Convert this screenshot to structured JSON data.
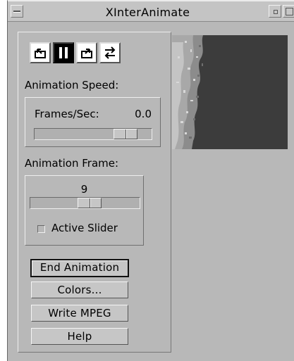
{
  "window": {
    "title": "XInterAnimate"
  },
  "controls": {
    "buttons": [
      {
        "name": "step-backward",
        "icon": "step-backward-icon"
      },
      {
        "name": "pause",
        "icon": "pause-icon",
        "active": true
      },
      {
        "name": "step-forward",
        "icon": "step-forward-icon"
      },
      {
        "name": "loop-toggle",
        "icon": "loop-arrows-icon"
      }
    ]
  },
  "speed": {
    "heading": "Animation Speed:",
    "frames_label": "Frames/Sec:",
    "frames_value": "0.0",
    "slider_position": 0.85
  },
  "frame": {
    "heading": "Animation Frame:",
    "value": "9",
    "slider_position": 0.55,
    "active_slider_label": "Active Slider",
    "active_slider_checked": false
  },
  "actions": {
    "end_animation": "End Animation",
    "colors": "Colors...",
    "write_mpeg": "Write MPEG",
    "help": "Help"
  },
  "colors": {
    "window_bg": "#b8b8b8",
    "preview_dark": "#3c3c3c",
    "preview_light": "#b0b0b0"
  }
}
